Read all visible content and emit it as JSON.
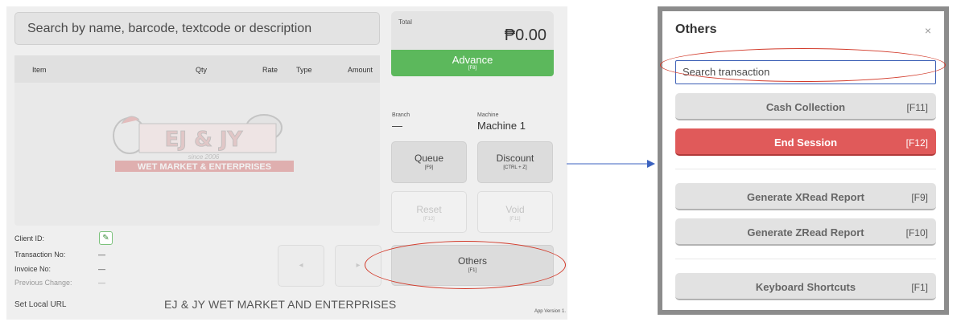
{
  "pos": {
    "search_placeholder": "Search by name, barcode, textcode or description",
    "table_headers": [
      "Item",
      "Qty",
      "Rate",
      "Type",
      "Amount"
    ],
    "logo": {
      "line1": "EJ & JY",
      "line2": "since 2006",
      "line3": "WET MARKET & ENTERPRISES"
    },
    "info": [
      {
        "label": "Client ID:",
        "value": ""
      },
      {
        "label": "Transaction No:",
        "value": "—"
      },
      {
        "label": "Invoice No:",
        "value": "—"
      },
      {
        "label": "Previous Change:",
        "value": "—"
      }
    ],
    "total_label": "Total",
    "total_value": "₱0.00",
    "advance_label": "Advance",
    "advance_key": "[F8]",
    "branch_label": "Branch",
    "branch_value": "—",
    "machine_label": "Machine",
    "machine_value": "Machine 1",
    "buttons": {
      "queue": {
        "label": "Queue",
        "key": "[F9]"
      },
      "discount": {
        "label": "Discount",
        "key": "[CTRL + Z]"
      },
      "reset": {
        "label": "Reset",
        "key": "[F12]"
      },
      "void": {
        "label": "Void",
        "key": "[F11]"
      },
      "others": {
        "label": "Others",
        "key": "[F1]"
      }
    },
    "prev_icon": "◂",
    "next_icon": "▸",
    "footer_link": "Set Local URL",
    "brand": "EJ & JY WET MARKET AND ENTERPRISES",
    "version": "App Version 1."
  },
  "modal": {
    "title": "Others",
    "close": "×",
    "search_placeholder": "Search transaction",
    "buttons": [
      {
        "label": "Cash Collection",
        "key": "[F11]"
      },
      {
        "label": "End Session",
        "key": "[F12]"
      },
      {
        "label": "Generate XRead Report",
        "key": "[F9]"
      },
      {
        "label": "Generate ZRead Report",
        "key": "[F10]"
      },
      {
        "label": "Keyboard Shortcuts",
        "key": "[F1]"
      }
    ]
  },
  "colors": {
    "advance": "#5cb85c",
    "end_session": "#e05a5a",
    "highlight": "#d23a2a",
    "arrow": "#3b62c0",
    "search_border": "#3a5eb5"
  }
}
